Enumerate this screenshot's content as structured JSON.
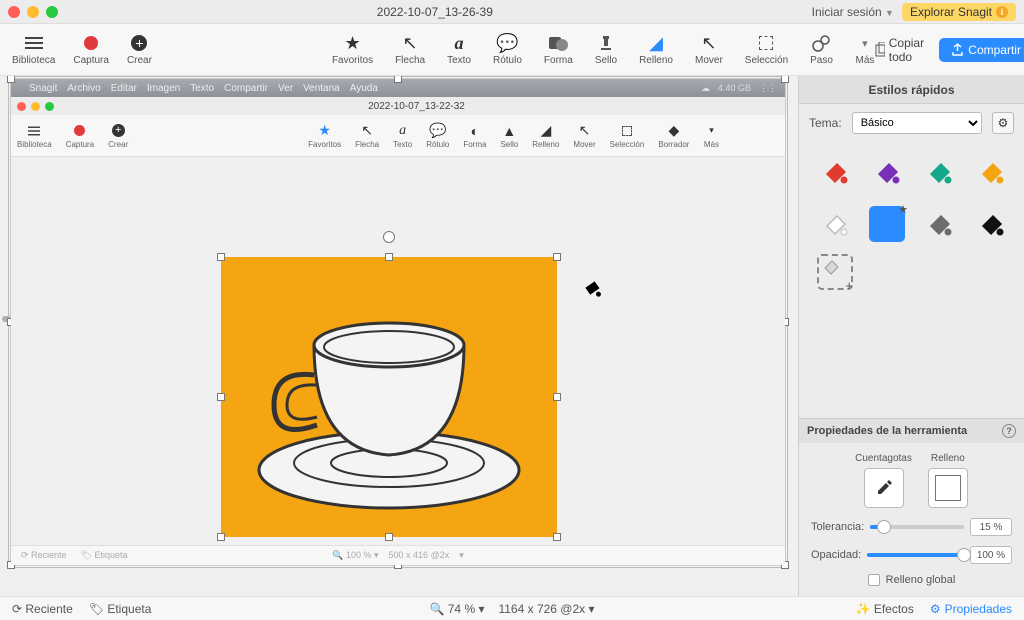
{
  "titlebar": {
    "title": "2022-10-07_13-26-39",
    "login": "Iniciar sesión",
    "explore": "Explorar Snagit"
  },
  "toolbar": {
    "left": [
      {
        "label": "Biblioteca",
        "icon": "library-icon"
      },
      {
        "label": "Captura",
        "icon": "record-icon"
      },
      {
        "label": "Crear",
        "icon": "add-icon"
      }
    ],
    "tools": [
      {
        "label": "Favoritos",
        "icon": "star-icon"
      },
      {
        "label": "Flecha",
        "icon": "arrow-icon"
      },
      {
        "label": "Texto",
        "icon": "text-icon"
      },
      {
        "label": "Rótulo",
        "icon": "callout-icon"
      },
      {
        "label": "Forma",
        "icon": "shape-icon"
      },
      {
        "label": "Sello",
        "icon": "stamp-icon"
      },
      {
        "label": "Relleno",
        "icon": "fill-icon"
      },
      {
        "label": "Mover",
        "icon": "move-icon"
      },
      {
        "label": "Selección",
        "icon": "selection-icon"
      },
      {
        "label": "Paso",
        "icon": "step-icon"
      }
    ],
    "more": "Más",
    "copy_all": "Copiar todo",
    "share": "Compartir"
  },
  "inner": {
    "menubar": [
      "Snagit",
      "Archivo",
      "Editar",
      "Imagen",
      "Texto",
      "Compartir",
      "Ver",
      "Ventana",
      "Ayuda"
    ],
    "storage": "4.40 GB",
    "title": "2022-10-07_13-22-32",
    "tb_left": [
      {
        "label": "Biblioteca"
      },
      {
        "label": "Captura"
      },
      {
        "label": "Crear"
      }
    ],
    "tb_tools": [
      {
        "label": "Favoritos"
      },
      {
        "label": "Flecha"
      },
      {
        "label": "Texto"
      },
      {
        "label": "Rótulo"
      },
      {
        "label": "Forma"
      },
      {
        "label": "Sello"
      },
      {
        "label": "Relleno"
      },
      {
        "label": "Mover"
      },
      {
        "label": "Selección"
      },
      {
        "label": "Borrador"
      }
    ],
    "more": "Más",
    "status_recent": "Reciente",
    "status_tag": "Etiqueta",
    "status_zoom": "100 %",
    "status_dim": "500 x 416 @2x"
  },
  "statusbar": {
    "recent": "Reciente",
    "tag": "Etiqueta",
    "zoom": "74 %",
    "dim": "1164 x 726 @2x",
    "effects": "Efectos",
    "properties": "Propiedades"
  },
  "rpanel": {
    "quick_styles": "Estilos rápidos",
    "theme_label": "Tema:",
    "theme_value": "Básico",
    "props_title": "Propiedades de la herramienta",
    "eyedropper": "Cuentagotas",
    "fill": "Relleno",
    "tolerance_label": "Tolerancia:",
    "tolerance_value": "15 %",
    "tolerance_pct": 15,
    "opacity_label": "Opacidad:",
    "opacity_value": "100 %",
    "opacity_pct": 100,
    "global_fill": "Relleno global",
    "swatches": [
      {
        "color": "#e23b2e"
      },
      {
        "color": "#7a2fb8"
      },
      {
        "color": "#14a88a"
      },
      {
        "color": "#f5a511"
      },
      {
        "color": "#ffffff",
        "outline": true
      },
      {
        "color": "#2a8cff",
        "selected": true,
        "star": true
      },
      {
        "color": "#6d6d6d"
      },
      {
        "color": "#111111"
      }
    ]
  }
}
